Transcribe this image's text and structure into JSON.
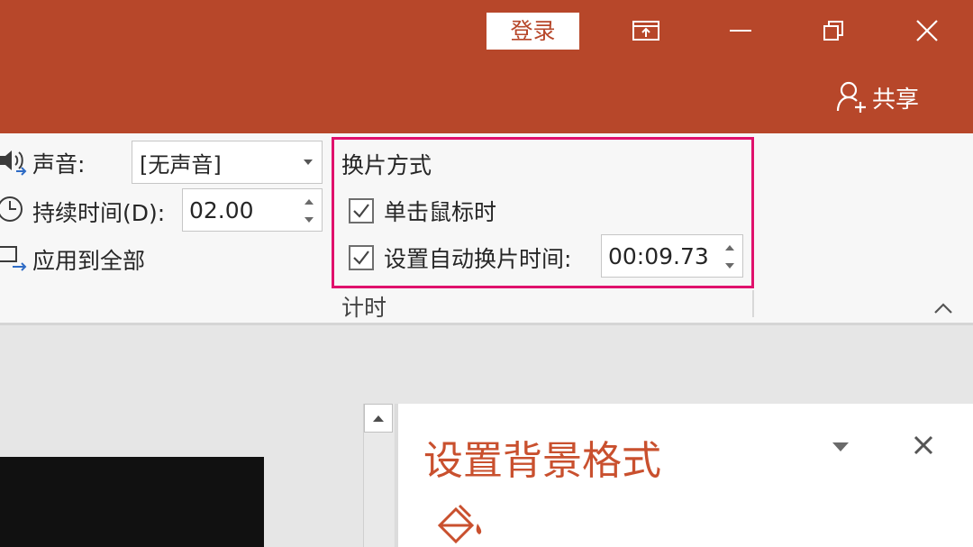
{
  "titlebar": {
    "login_label": "登录",
    "share_label": "共享",
    "bg_color": "#b7472a",
    "icons": [
      "ribbon-display-options-icon",
      "minimize-icon",
      "restore-icon",
      "close-icon",
      "add-person-icon"
    ]
  },
  "ribbon": {
    "sound": {
      "label": "声音:",
      "value": "[无声音]"
    },
    "duration": {
      "label": "持续时间(D):",
      "value": "02.00"
    },
    "apply_all": {
      "label": "应用到全部"
    },
    "advance_slide": {
      "title": "换片方式",
      "on_mouse_click": {
        "label": "单击鼠标时",
        "checked": true
      },
      "after_time": {
        "label": "设置自动换片时间:",
        "checked": true,
        "value": "00:09.73"
      }
    },
    "group_name": "计时",
    "highlight_color": "#e0116c"
  },
  "format_pane": {
    "title": "设置背景格式",
    "title_color": "#c9502e",
    "icons": [
      "dropdown-arrow-icon",
      "close-icon",
      "fill-bucket-icon"
    ]
  }
}
